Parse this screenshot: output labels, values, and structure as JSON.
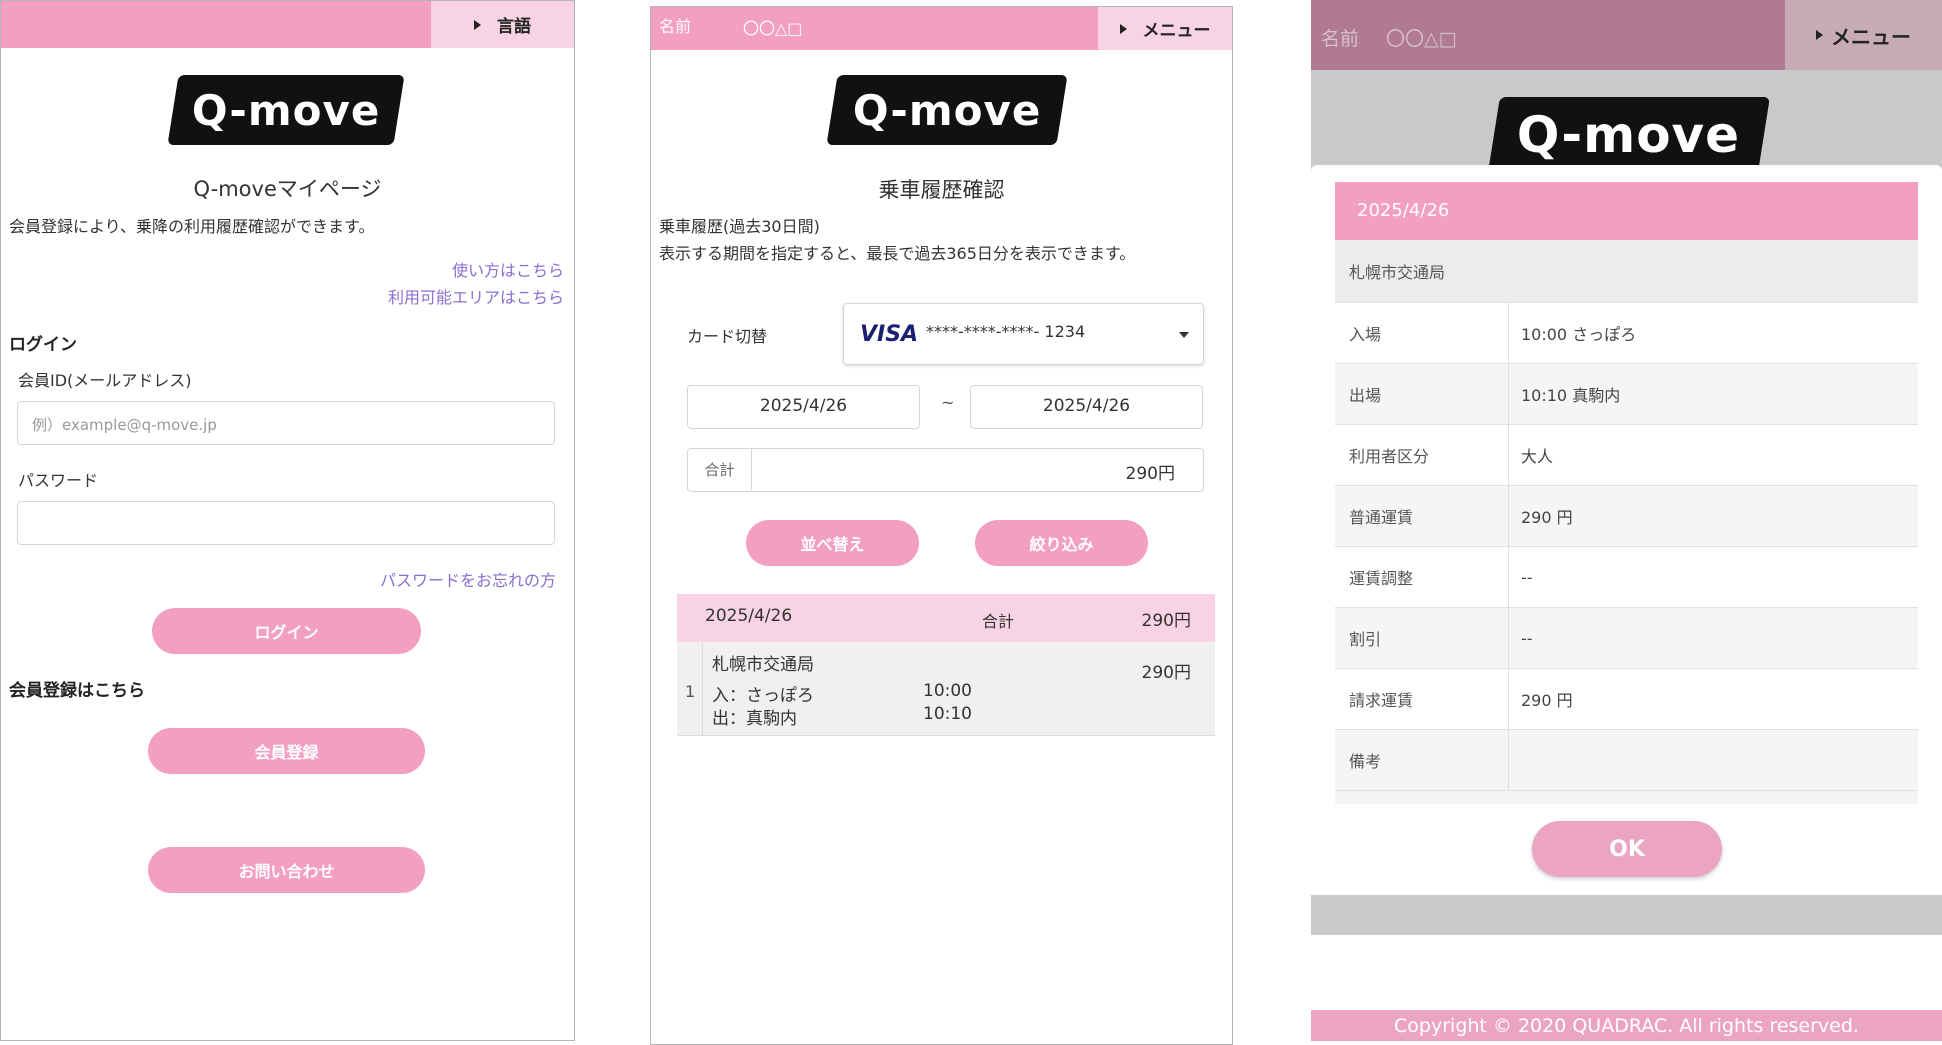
{
  "login_screen": {
    "language_label": "言語",
    "logo_text": "Q-move",
    "page_title": "Q-moveマイページ",
    "description": "会員登録により、乗降の利用履歴確認ができます。",
    "links": {
      "how_to_use": "使い方はこちら",
      "available_area": "利用可能エリアはこちら",
      "forgot_password": "パスワードをお忘れの方"
    },
    "login_heading": "ログイン",
    "member_id_label": "会員ID(メールアドレス)",
    "member_id_placeholder": "例）example@q-move.jp",
    "password_label": "パスワード",
    "login_button": "ログイン",
    "register_heading": "会員登録はこちら",
    "register_button": "会員登録",
    "contact_button": "お問い合わせ"
  },
  "history_screen": {
    "name_label": "名前",
    "name_value": "〇〇△□",
    "menu_label": "メニュー",
    "logo_text": "Q-move",
    "page_title": "乗車履歴確認",
    "description_line1": "乗車履歴(過去30日間)",
    "description_line2": "表示する期間を指定すると、最長で過去365日分を表示できます。",
    "card_switch_label": "カード切替",
    "card_brand": "VISA",
    "card_number": "****-****-****- 1234",
    "date_from": "2025/4/26",
    "date_separator": "~",
    "date_to": "2025/4/26",
    "total_label": "合計",
    "total_value": "290円",
    "sort_button": "並べ替え",
    "filter_button": "絞り込み",
    "result": {
      "date": "2025/4/26",
      "total_label": "合計",
      "total_value": "290円",
      "entries": [
        {
          "index": "1",
          "operator": "札幌市交通局",
          "fare": "290円",
          "entry_label": "入：さっぽろ",
          "entry_time": "10:00",
          "exit_label": "出：真駒内",
          "exit_time": "10:10"
        }
      ]
    }
  },
  "detail_screen": {
    "name_label": "名前",
    "name_value": "〇〇△□",
    "menu_label": "メニュー",
    "logo_text": "Q-move",
    "modal": {
      "date": "2025/4/26",
      "operator": "札幌市交通局",
      "rows": [
        {
          "key": "入場",
          "value": "10:00 さっぽろ"
        },
        {
          "key": "出場",
          "value": "10:10 真駒内"
        },
        {
          "key": "利用者区分",
          "value": "大人"
        },
        {
          "key": "普通運賃",
          "value": "290 円"
        },
        {
          "key": "運賃調整",
          "value": "--"
        },
        {
          "key": "割引",
          "value": "--"
        },
        {
          "key": "請求運賃",
          "value": "290 円"
        },
        {
          "key": "備考",
          "value": ""
        }
      ],
      "ok_button": "OK"
    },
    "copyright": "Copyright © 2020 QUADRAC. All rights reserved."
  },
  "colors": {
    "accent_pink": "#f29fc1",
    "light_pink": "#f7d3e3",
    "link_purple": "#8a6fcf",
    "visa_blue": "#1a1f71"
  }
}
